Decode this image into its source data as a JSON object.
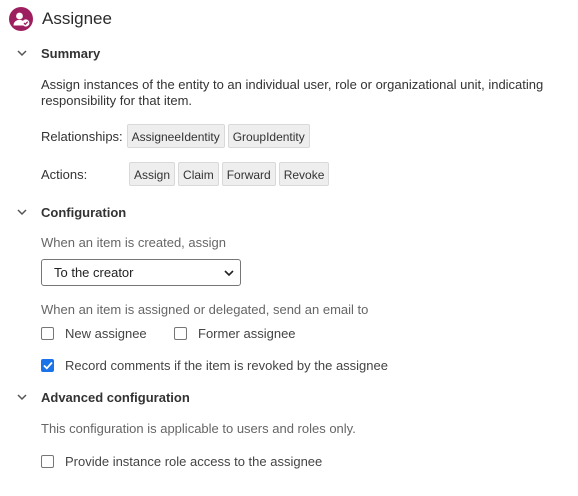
{
  "header": {
    "title": "Assignee",
    "icon": "assignee-avatar-icon",
    "accent": "#9e1f5f"
  },
  "summary": {
    "title": "Summary",
    "description": "Assign instances of the entity to an individual user, role or organizational unit, indicating responsibility for that item.",
    "relationships_label": "Relationships:",
    "relationships": [
      "AssigneeIdentity",
      "GroupIdentity"
    ],
    "actions_label": "Actions:",
    "actions": [
      "Assign",
      "Claim",
      "Forward",
      "Revoke"
    ]
  },
  "configuration": {
    "title": "Configuration",
    "assign_label": "When an item is created, assign",
    "assign_value": "To the creator",
    "email_label": "When an item is assigned or delegated, send an email to",
    "new_assignee": {
      "label": "New assignee",
      "checked": false
    },
    "former_assignee": {
      "label": "Former assignee",
      "checked": false
    },
    "record_comments": {
      "label": "Record comments if the item is revoked by the assignee",
      "checked": true
    }
  },
  "advanced": {
    "title": "Advanced configuration",
    "note": "This configuration is applicable to users and roles only.",
    "role_access": {
      "label": "Provide instance role access to the assignee",
      "checked": false
    }
  }
}
